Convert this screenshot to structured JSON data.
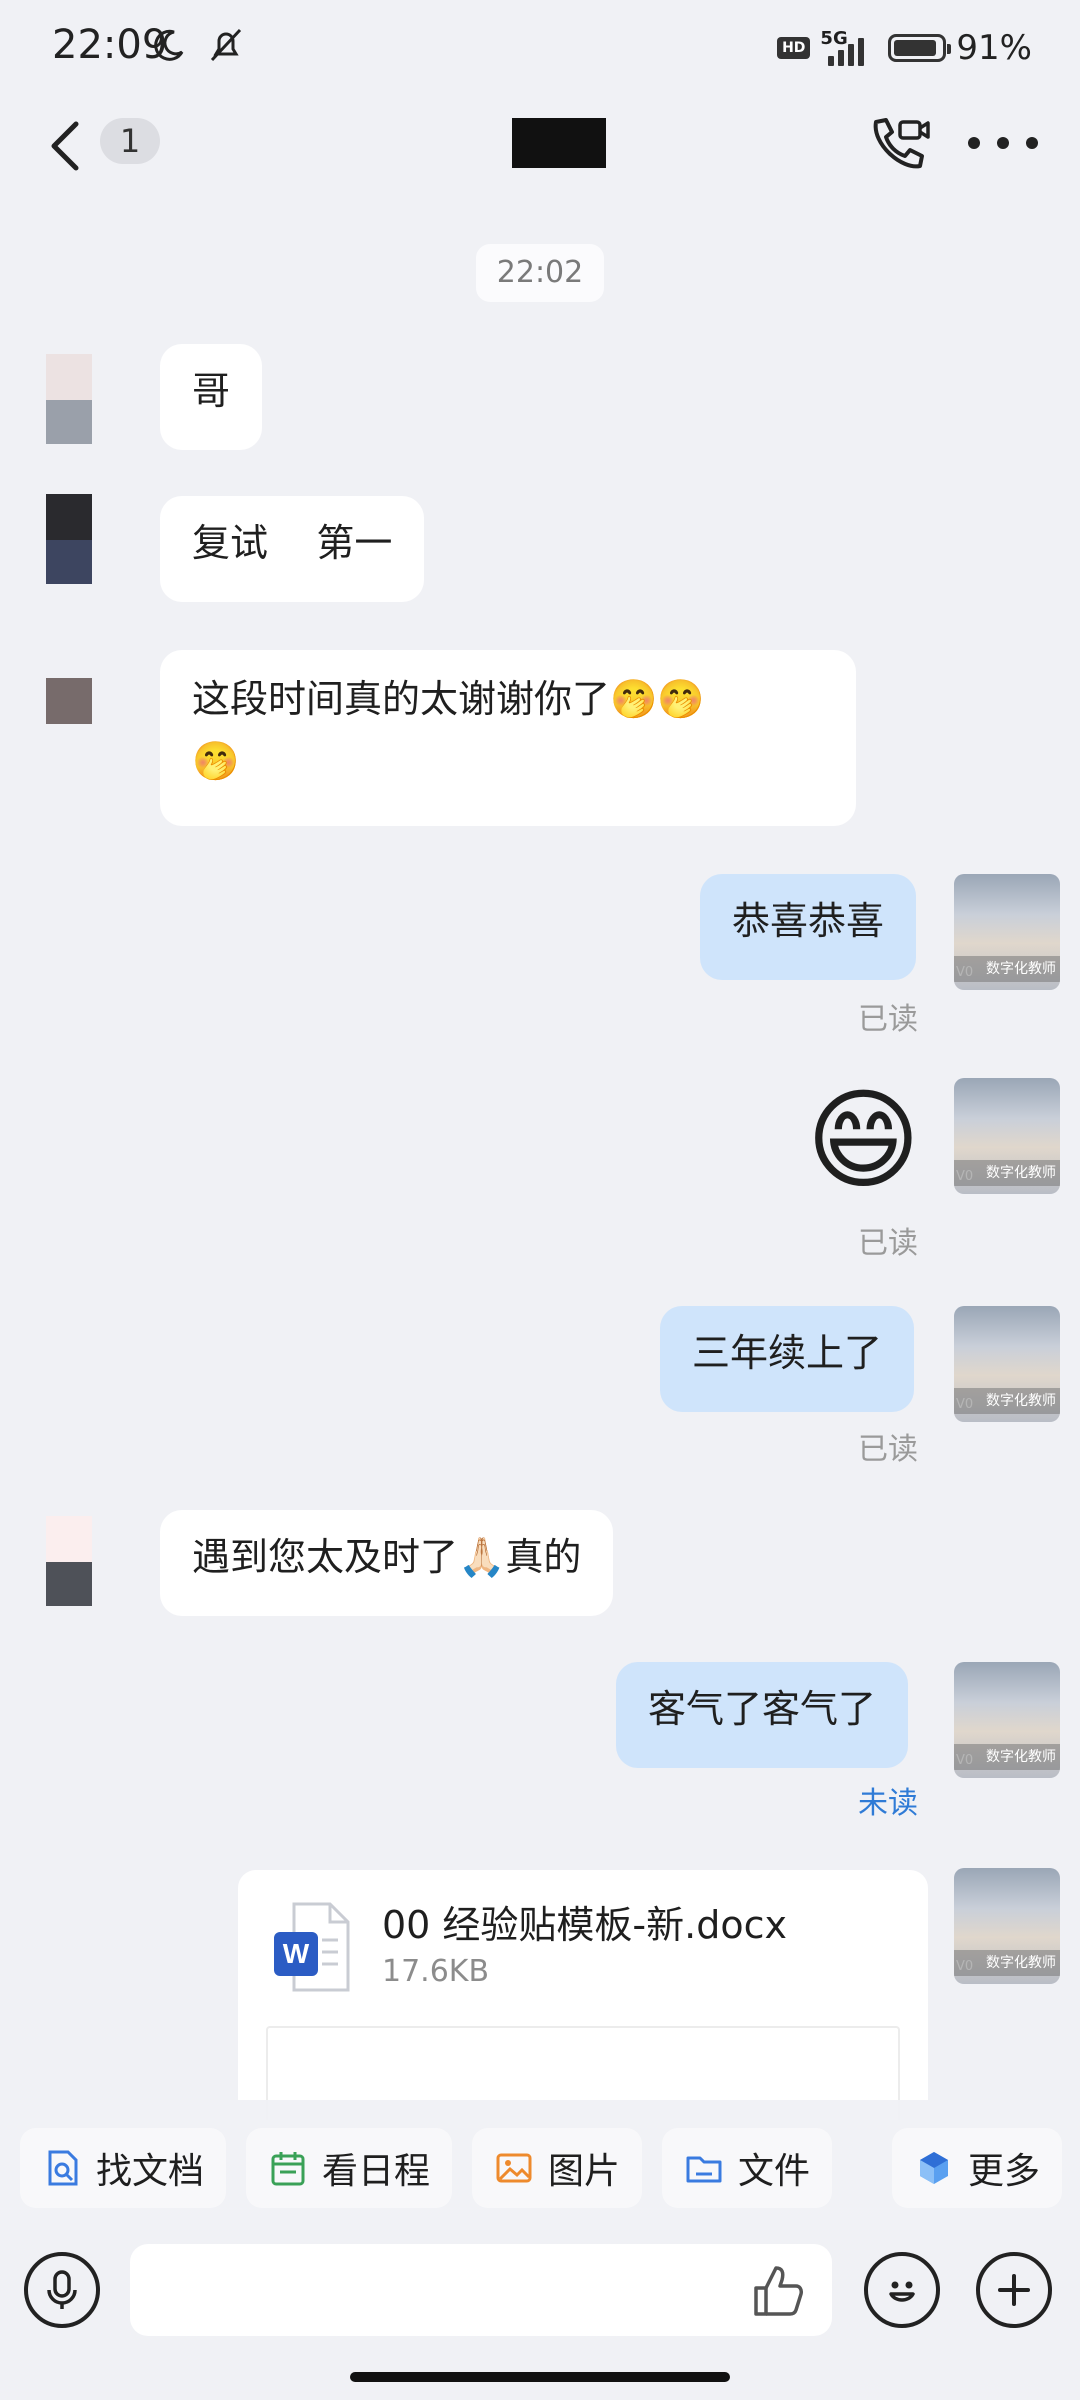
{
  "status_bar": {
    "time": "22:09",
    "network": "5G",
    "hd": "HD",
    "battery_percent": "91%",
    "battery_level": 0.91
  },
  "header": {
    "unread_count": "1"
  },
  "chat": {
    "time_separator": "22:02",
    "messages": [
      {
        "side": "left",
        "text": "哥"
      },
      {
        "side": "left",
        "text": "复试    第一"
      },
      {
        "side": "left",
        "text": "这段时间真的太谢谢你了🤭🤭",
        "text2": "🤭"
      },
      {
        "side": "right",
        "text": "恭喜恭喜",
        "status": "已读"
      },
      {
        "side": "right",
        "text": "😄",
        "status": "已读"
      },
      {
        "side": "right",
        "text": "三年续上了",
        "status": "已读"
      },
      {
        "side": "left",
        "text": "遇到您太及时了🙏🏻真的"
      },
      {
        "side": "right",
        "text": "客气了客气了",
        "status": "未读"
      }
    ],
    "avatar_caption": "数字化教师",
    "avatar_badge": "V0",
    "file": {
      "name": "00 经验贴模板-新.docx",
      "size": "17.6KB"
    }
  },
  "quick_actions": [
    {
      "label": "找文档",
      "icon": "doc-search-icon"
    },
    {
      "label": "看日程",
      "icon": "calendar-icon"
    },
    {
      "label": "图片",
      "icon": "image-icon"
    },
    {
      "label": "文件",
      "icon": "folder-icon"
    },
    {
      "label": "更多",
      "icon": "more-apps-icon"
    }
  ],
  "input": {
    "placeholder": ""
  },
  "colors": {
    "background": "#f0f1f5",
    "bubble_self": "#cfe4fb",
    "bubble_other": "#ffffff",
    "unread": "#2f7bd6",
    "read": "#9a9a9a"
  }
}
